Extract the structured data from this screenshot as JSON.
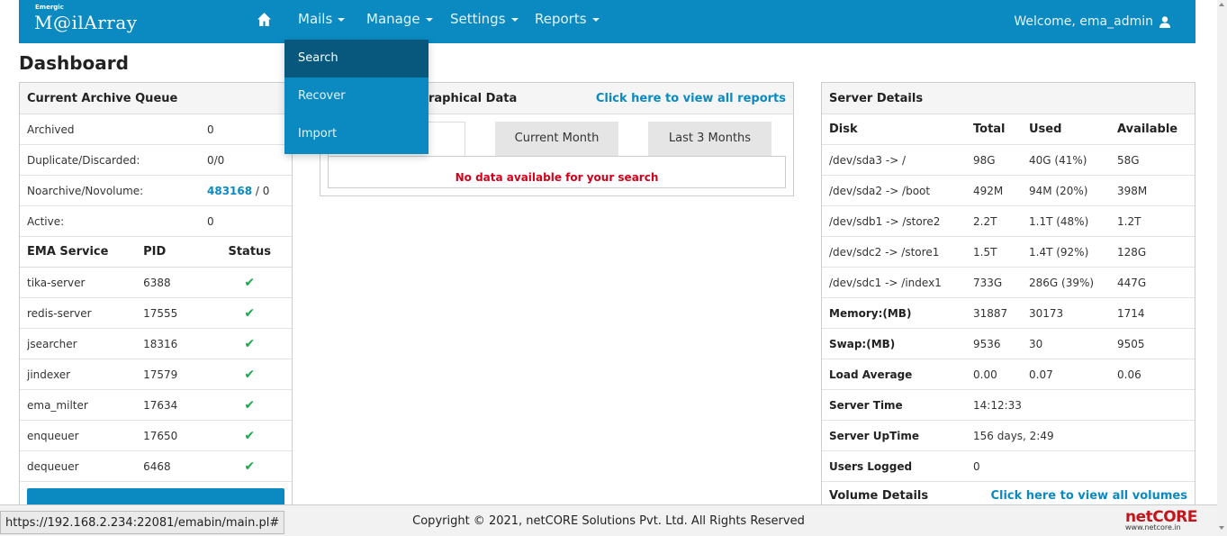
{
  "navbar": {
    "brand_small": "Emergic",
    "brand": "M@ilArray",
    "menus": [
      "Mails",
      "Manage",
      "Settings",
      "Reports"
    ],
    "welcome": "Welcome, ema_admin"
  },
  "dropdown": {
    "items": [
      "Search",
      "Recover",
      "Import"
    ],
    "active": "Search"
  },
  "page_title": "Dashboard",
  "archive_queue": {
    "title": "Current Archive Queue",
    "rows": [
      {
        "label": "Archived",
        "value": "0"
      },
      {
        "label": "Duplicate/Discarded:",
        "value": "0/0"
      },
      {
        "label": "Noarchive/Novolume:",
        "value_link": "483168",
        "value_rest": " / 0"
      },
      {
        "label": "Active:",
        "value": "0"
      }
    ]
  },
  "services": {
    "headers": [
      "EMA Service",
      "PID",
      "Status"
    ],
    "rows": [
      {
        "name": "tika-server",
        "pid": "6388",
        "status": "ok"
      },
      {
        "name": "redis-server",
        "pid": "17555",
        "status": "ok"
      },
      {
        "name": "jsearcher",
        "pid": "18316",
        "status": "ok"
      },
      {
        "name": "jindexer",
        "pid": "17579",
        "status": "ok"
      },
      {
        "name": "ema_milter",
        "pid": "17634",
        "status": "ok"
      },
      {
        "name": "enqueuer",
        "pid": "17650",
        "status": "ok"
      },
      {
        "name": "dequeuer",
        "pid": "6468",
        "status": "ok"
      }
    ],
    "check_glyph": "✔"
  },
  "graph": {
    "title_visible": "raphical Data",
    "link": "Click here to view all reports",
    "tabs": [
      "",
      "Current Month",
      "Last 3 Months"
    ],
    "no_data": "No data available for your search"
  },
  "server": {
    "title": "Server Details",
    "headers": [
      "Disk",
      "Total",
      "Used",
      "Available"
    ],
    "disks": [
      {
        "disk": "/dev/sda3 -> /",
        "total": "98G",
        "used": "40G (41%)",
        "avail": "58G"
      },
      {
        "disk": "/dev/sda2 -> /boot",
        "total": "492M",
        "used": "94M (20%)",
        "avail": "398M"
      },
      {
        "disk": "/dev/sdb1 -> /store2",
        "total": "2.2T",
        "used": "1.1T (48%)",
        "avail": "1.2T"
      },
      {
        "disk": "/dev/sdc2 -> /store1",
        "total": "1.5T",
        "used": "1.4T (92%)",
        "avail": "128G"
      },
      {
        "disk": "/dev/sdc1 -> /index1",
        "total": "733G",
        "used": "286G (39%)",
        "avail": "447G"
      }
    ],
    "memory": {
      "label": "Memory:(MB)",
      "total": "31887",
      "used": "30173",
      "avail": "1714"
    },
    "swap": {
      "label": "Swap:(MB)",
      "total": "9536",
      "used": "30",
      "avail": "9505"
    },
    "load": {
      "label": "Load Average",
      "a": "0.00",
      "b": "0.07",
      "c": "0.06"
    },
    "time": {
      "label": "Server Time",
      "value": "14:12:33"
    },
    "uptime": {
      "label": "Server UpTime",
      "value": "156 days, 2:49"
    },
    "users": {
      "label": "Users Logged",
      "value": "0"
    },
    "volume": {
      "label": "Volume Details",
      "link": "Click here to view all volumes"
    }
  },
  "footer": {
    "copyright": "Copyright © 2021, netCORE Solutions Pvt. Ltd. All Rights Reserved",
    "logo": "netCORE",
    "logo_url": "www.netcore.in"
  },
  "status_url": "https://192.168.2.234:22081/emabin/main.pl#",
  "colors": {
    "primary": "#0a8ac0",
    "active_menu": "#07587c",
    "error": "#d0021b",
    "success": "#1aa84c"
  }
}
